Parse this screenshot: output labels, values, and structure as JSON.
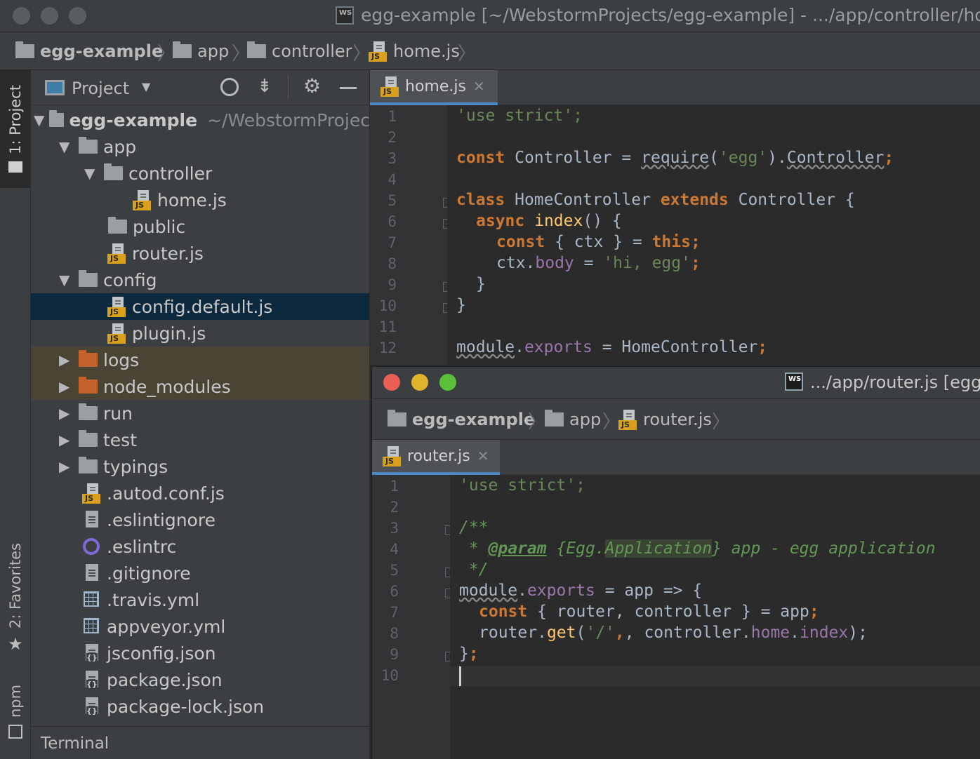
{
  "main_window": {
    "title": "egg-example [~/WebstormProjects/egg-example] - .../app/controller/hom",
    "app_badge": "WS"
  },
  "breadcrumb": [
    "egg-example",
    "app",
    "controller",
    "home.js"
  ],
  "tool_strip": {
    "project": "1: Project",
    "favorites": "2: Favorites",
    "npm": "npm"
  },
  "project_panel": {
    "title": "Project",
    "root_name": "egg-example",
    "root_path": "~/WebstormProjec",
    "items": [
      {
        "name": "app"
      },
      {
        "name": "controller"
      },
      {
        "name": "home.js"
      },
      {
        "name": "public"
      },
      {
        "name": "router.js"
      },
      {
        "name": "config"
      },
      {
        "name": "config.default.js"
      },
      {
        "name": "plugin.js"
      },
      {
        "name": "logs"
      },
      {
        "name": "node_modules"
      },
      {
        "name": "run"
      },
      {
        "name": "test"
      },
      {
        "name": "typings"
      },
      {
        "name": ".autod.conf.js"
      },
      {
        "name": ".eslintignore"
      },
      {
        "name": ".eslintrc"
      },
      {
        "name": ".gitignore"
      },
      {
        "name": ".travis.yml"
      },
      {
        "name": "appveyor.yml"
      },
      {
        "name": "jsconfig.json"
      },
      {
        "name": "package.json"
      },
      {
        "name": "package-lock.json"
      }
    ]
  },
  "terminal": "Terminal",
  "editor1": {
    "tab": "home.js",
    "line_numbers": [
      "1",
      "2",
      "3",
      "4",
      "5",
      "6",
      "7",
      "8",
      "9",
      "10",
      "11",
      "12"
    ],
    "code": {
      "l1": "'use strict';",
      "l3_kw": "const",
      "l3_a": " Controller = ",
      "l3_req": "require",
      "l3_b": "(",
      "l3_str": "'egg'",
      "l3_c": ").",
      "l3_ctrl": "Controller",
      "l3_end": ";",
      "l5_kw": "class",
      "l5_a": " HomeController ",
      "l5_kw2": "extends",
      "l5_b": " Controller {",
      "l6_kw": "async",
      "l6_fn": " index",
      "l6_a": "() {",
      "l7_kw": "const",
      "l7_a": " { ctx } = ",
      "l7_kw2": "this;",
      "l8_a": "ctx.",
      "l8_p": "body",
      "l8_b": " = ",
      "l8_s": "'hi, egg'",
      "l8_end": ";",
      "l9": "}",
      "l10": "}",
      "l12_mod": "module",
      "l12_a": ".",
      "l12_p": "exports",
      "l12_b": " = HomeController",
      "l12_end": ";"
    }
  },
  "window2": {
    "title": ".../app/router.js [egg",
    "app_badge": "WS",
    "breadcrumb": [
      "egg-example",
      "app",
      "router.js"
    ],
    "tab": "router.js",
    "line_numbers": [
      "1",
      "2",
      "3",
      "4",
      "5",
      "6",
      "7",
      "8",
      "9",
      "10"
    ],
    "code": {
      "l1": "'use strict';",
      "l3": "/**",
      "l4_a": " * ",
      "l4_tag": "@param",
      "l4_b": " {Egg.",
      "l4_hl": "Application",
      "l4_c": "} app - egg application",
      "l5": " */",
      "l6_mod": "module",
      "l6_a": ".",
      "l6_p": "exports",
      "l6_b": " = app => {",
      "l7_kw": "const",
      "l7_a": " { router, controller } = app",
      "l7_end": ";",
      "l8_a": "router.",
      "l8_fn": "get",
      "l8_b": "(",
      "l8_s": "'/'",
      "l8_c": ", controller.",
      "l8_p1": "home",
      "l8_d": ".",
      "l8_p2": "index",
      "l8_end": ");",
      "l9_a": "}",
      "l9_end": ";"
    }
  },
  "colors": {
    "keyword": "#cc7832",
    "string": "#6a8759",
    "property": "#9876aa",
    "function": "#ffc66d",
    "comment": "#629755",
    "selection": "#0d293e",
    "tab_underline": "#4a88c7",
    "close_light": "#ec5f57",
    "minimize_light": "#e0b32d",
    "zoom_light": "#5cbf3c"
  }
}
